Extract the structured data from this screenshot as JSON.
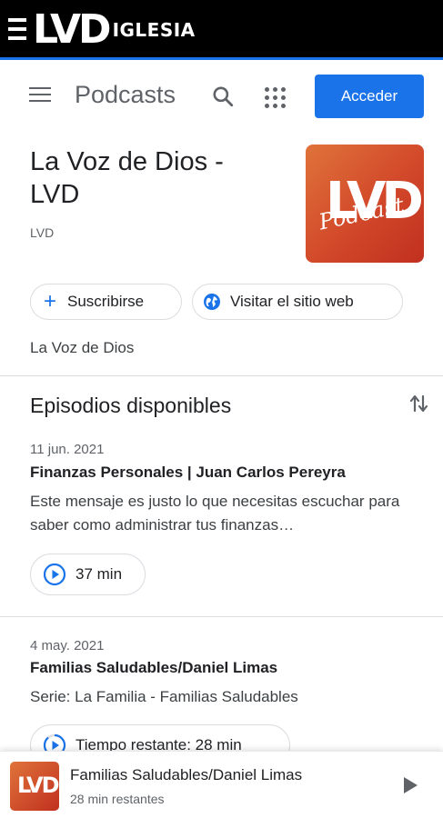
{
  "brand": {
    "logo_mark": "LVD",
    "logo_text": "IGLESIA"
  },
  "header": {
    "title": "Podcasts",
    "search_icon": "search-icon",
    "apps_icon": "apps-grid-icon",
    "login_label": "Acceder"
  },
  "podcast": {
    "title": "La Voz de Dios - LVD",
    "author": "LVD",
    "cover_mark": "LVD",
    "cover_script": "Podcast",
    "subscribe_label": "Suscribirse",
    "visit_label": "Visitar el sitio web",
    "description": "La Voz de Dios"
  },
  "episodes": {
    "heading": "Episodios disponibles",
    "items": [
      {
        "date": "11 jun. 2021",
        "title": "Finanzas Personales | Juan Carlos Pereyra",
        "description": "Este mensaje es justo lo que necesitas escuchar para saber como administrar tus finanzas…",
        "duration": "37 min"
      },
      {
        "date": "4 may. 2021",
        "title": "Familias Saludables/Daniel Limas",
        "description": "Serie: La Familia - Familias Saludables",
        "duration": "Tiempo restante: 28 min"
      }
    ]
  },
  "player": {
    "cover_mark": "LVD",
    "title": "Familias Saludables/Daniel Limas",
    "subtitle": "28 min restantes"
  },
  "colors": {
    "accent": "#1a73e8",
    "brand_bar": "#000000",
    "cover_start": "#e0733a",
    "cover_end": "#c0301f"
  }
}
